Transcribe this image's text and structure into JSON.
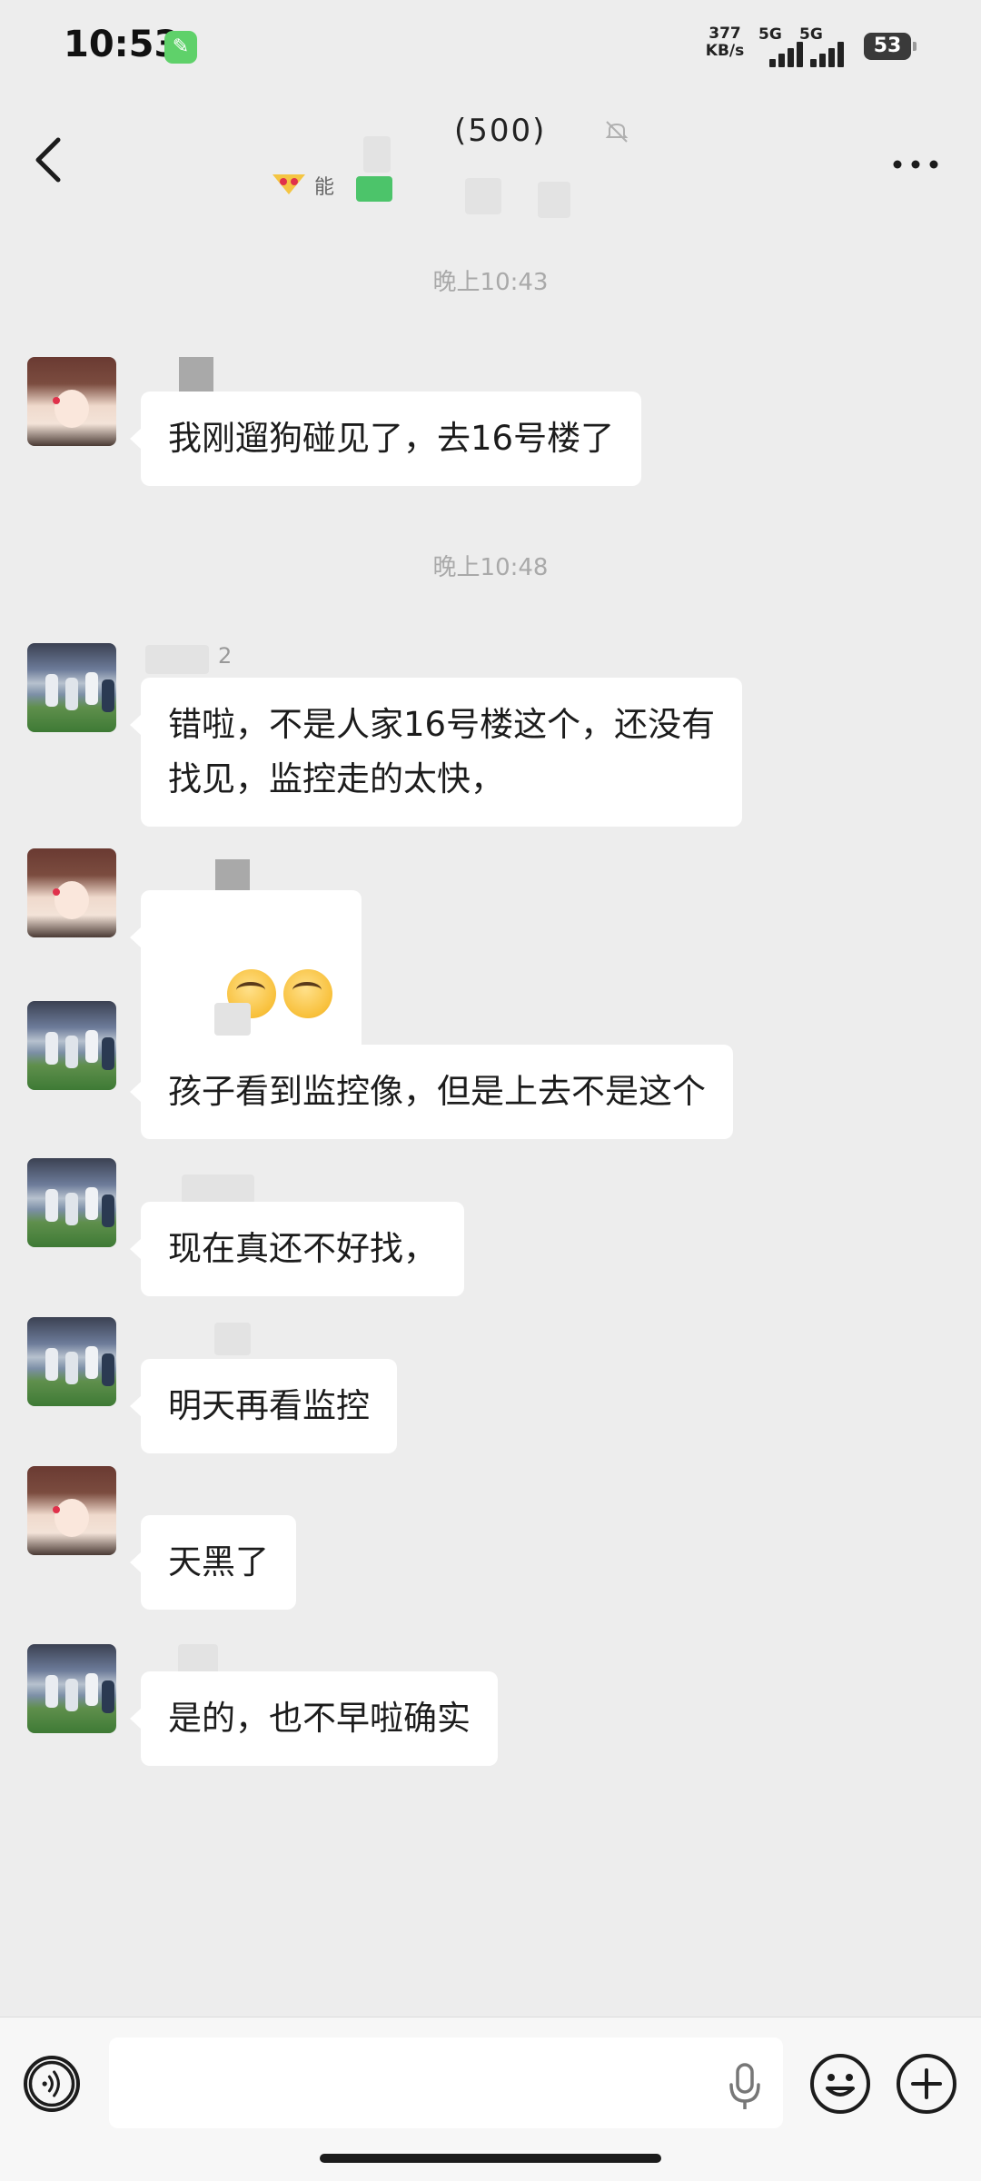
{
  "status_bar": {
    "time": "10:53",
    "net_speed_value": "377",
    "net_speed_unit": "KB/s",
    "sim1_label": "5G",
    "sim2_label": "5G",
    "battery": "53"
  },
  "header": {
    "title": "(500)",
    "group_note": "能",
    "icons": [
      "back-icon",
      "mute-icon",
      "more-icon"
    ]
  },
  "messages": [
    {
      "type": "timestamp",
      "text": "晚上10:43"
    },
    {
      "type": "msg",
      "avatar": "girl",
      "sender": "",
      "text": "我刚遛狗碰见了，去16号楼了"
    },
    {
      "type": "timestamp",
      "text": "晚上10:48"
    },
    {
      "type": "msg",
      "avatar": "field",
      "sender": "2",
      "text": "错啦，不是人家16号楼这个，还没有\n找见，监控走的太快，"
    },
    {
      "type": "msg",
      "avatar": "girl",
      "sender": "",
      "text": "",
      "emoji": "facepalm-emoji x2"
    },
    {
      "type": "msg",
      "avatar": "field",
      "sender": "",
      "text": "孩子看到监控像，但是上去不是这个"
    },
    {
      "type": "msg",
      "avatar": "field",
      "sender": "",
      "text": "现在真还不好找，"
    },
    {
      "type": "msg",
      "avatar": "field",
      "sender": "",
      "text": "明天再看监控"
    },
    {
      "type": "msg",
      "avatar": "girl",
      "sender": "",
      "text": "天黑了"
    },
    {
      "type": "msg",
      "avatar": "field",
      "sender": "",
      "text": "是的，也不早啦确实"
    }
  ],
  "input": {
    "value": "",
    "placeholder": ""
  },
  "colors": {
    "background": "#ededed",
    "bubble": "#ffffff",
    "timestamp": "#a9a9a9",
    "wrench_badge": "#5fd16a"
  }
}
